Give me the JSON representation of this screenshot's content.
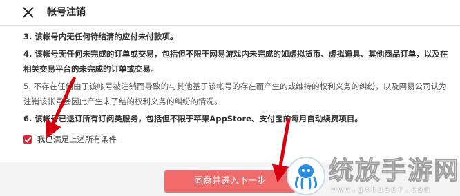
{
  "header": {
    "close_icon": "close-icon",
    "title": "帐号注销"
  },
  "conditions": [
    "3. 该帐号内无任何待结清的应付未付款项。",
    "4. 该帐号无任何未完成的订单或交易，包括但不限于网易游戏内未完成的如虚拟货币、虚拟道具、其他商品订单，以及在相关交易平台的未完成的订单或交易。",
    "5. 不存在任何由于该帐号被注销而导致的与其他基于该帐号的存在而产生的或维持的权利义务的纠纷，以及网易公司认为注销该帐号会因此产生未了结的权利义务的纠纷的情况。",
    "6. 该帐号已退订所有订阅类服务，包括但不限于苹果AppStore、支付宝的每月自动续费项目。"
  ],
  "agreement": {
    "checked": true,
    "label": "我已满足上述所有条件"
  },
  "next_button": {
    "label": "同意并进入下一步"
  },
  "watermark": {
    "text": "统放手游网",
    "url": "www.gxhuaer.com"
  },
  "colors": {
    "accent": "#d9283a",
    "button": "#f16b6b",
    "annotation_arrow": "#d6000f"
  }
}
